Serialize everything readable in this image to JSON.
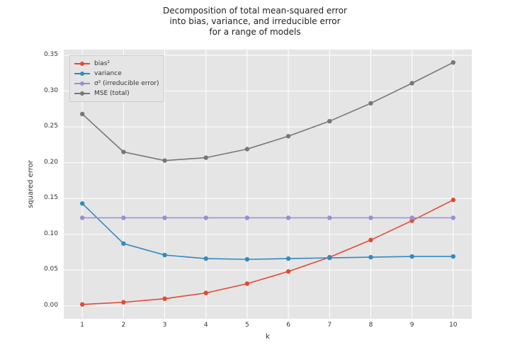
{
  "chart_data": {
    "type": "line",
    "title": "Decomposition of total mean-squared error\ninto bias, variance, and irreducible error\nfor a range of models",
    "xlabel": "k",
    "ylabel": "squared error",
    "x": [
      1,
      2,
      3,
      4,
      5,
      6,
      7,
      8,
      9,
      10
    ],
    "xlim": [
      0.55,
      10.45
    ],
    "ylim": [
      -0.018,
      0.358
    ],
    "yticks": [
      0.0,
      0.05,
      0.1,
      0.15,
      0.2,
      0.25,
      0.3,
      0.35
    ],
    "series": [
      {
        "name": "bias²",
        "color": "#e24a33",
        "values": [
          0.002,
          0.005,
          0.01,
          0.018,
          0.031,
          0.048,
          0.068,
          0.092,
          0.119,
          0.148
        ]
      },
      {
        "name": "variance",
        "color": "#348abd",
        "values": [
          0.143,
          0.087,
          0.071,
          0.066,
          0.065,
          0.066,
          0.067,
          0.068,
          0.069,
          0.069
        ]
      },
      {
        "name": "σ² (irreducible error)",
        "color": "#988ed5",
        "values": [
          0.123,
          0.123,
          0.123,
          0.123,
          0.123,
          0.123,
          0.123,
          0.123,
          0.123,
          0.123
        ]
      },
      {
        "name": "MSE (total)",
        "color": "#777777",
        "values": [
          0.268,
          0.215,
          0.203,
          0.207,
          0.219,
          0.237,
          0.258,
          0.283,
          0.311,
          0.34
        ]
      }
    ],
    "legend_position": "upper left",
    "grid": true
  },
  "ytick_labels": [
    "0.00",
    "0.05",
    "0.10",
    "0.15",
    "0.20",
    "0.25",
    "0.30",
    "0.35"
  ],
  "xtick_labels": [
    "1",
    "2",
    "3",
    "4",
    "5",
    "6",
    "7",
    "8",
    "9",
    "10"
  ]
}
